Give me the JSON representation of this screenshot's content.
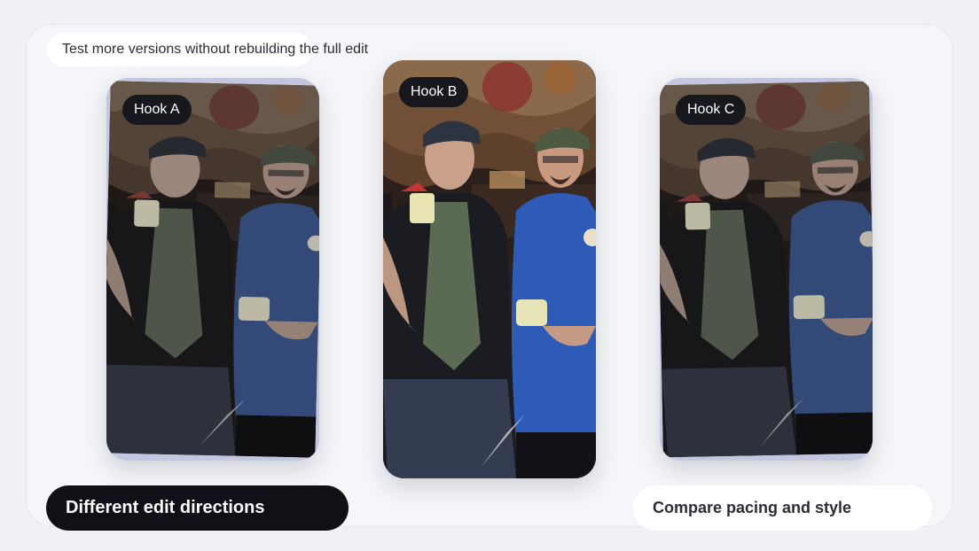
{
  "caption": "Test more versions without rebuilding the full edit",
  "cards": [
    {
      "label": "Hook A"
    },
    {
      "label": "Hook B"
    },
    {
      "label": "Hook C"
    }
  ],
  "footer": {
    "left_label": "Different edit directions",
    "right_label": "Compare pacing and style"
  },
  "colors": {
    "background": "#eff1f5",
    "dark_pill": "#0f1117",
    "tag": "#16181e",
    "card_frame": "#c3c7e0"
  }
}
